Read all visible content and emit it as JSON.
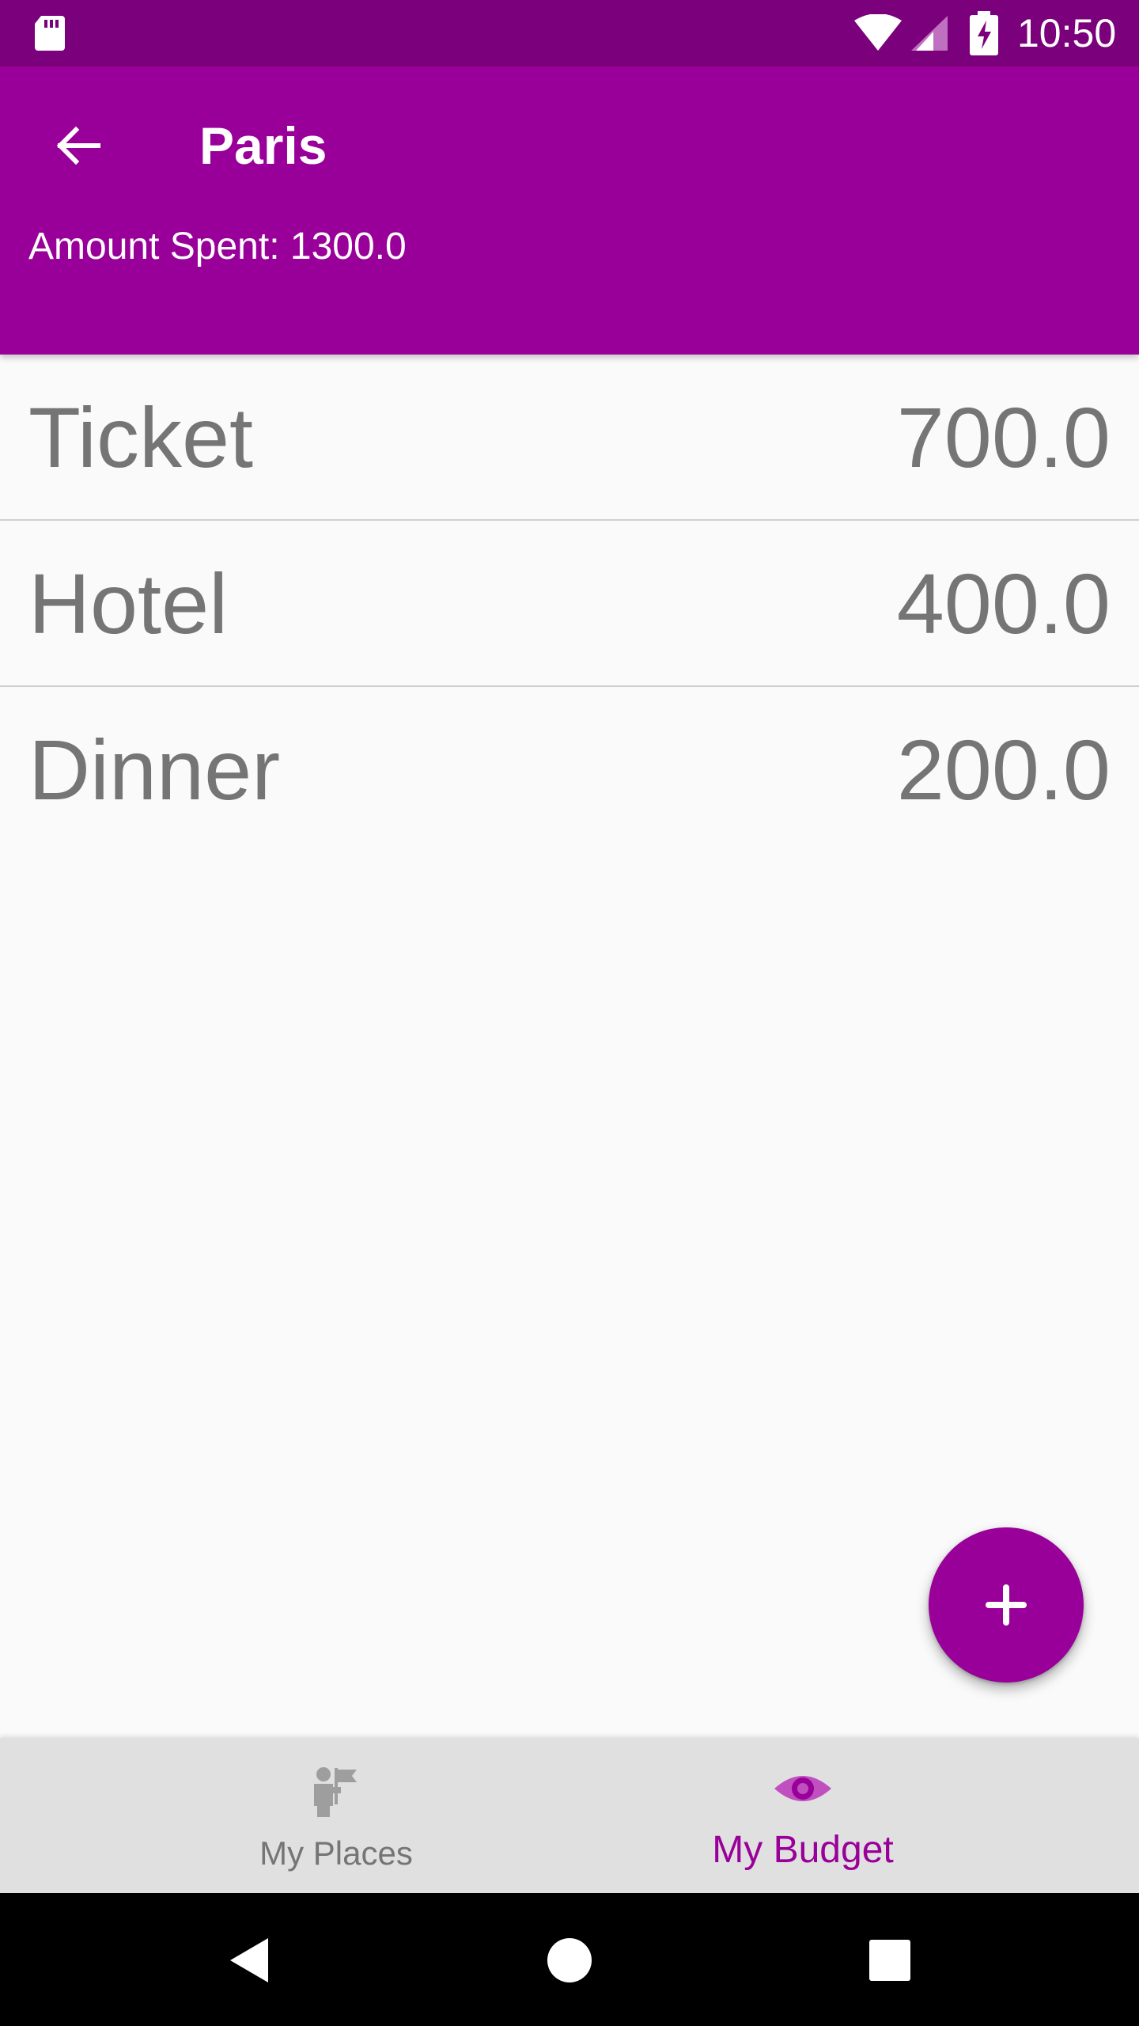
{
  "status_bar": {
    "time": "10:50",
    "icons": [
      "sd-card-icon",
      "wifi-icon",
      "cell-signal-icon",
      "battery-charging-icon"
    ]
  },
  "app_bar": {
    "title": "Paris",
    "subtitle": "Amount Spent: 1300.0",
    "back_icon": "arrow-back-icon"
  },
  "expenses": [
    {
      "name": "Ticket",
      "amount": "700.0"
    },
    {
      "name": "Hotel",
      "amount": "400.0"
    },
    {
      "name": "Dinner",
      "amount": "200.0"
    }
  ],
  "fab": {
    "icon": "plus-icon"
  },
  "bottom_nav": {
    "items": [
      {
        "label": "My Places",
        "icon": "places-icon",
        "active": false
      },
      {
        "label": "My Budget",
        "icon": "eye-icon",
        "active": true
      }
    ]
  },
  "system_nav": {
    "icons": [
      "back-triangle-icon",
      "home-circle-icon",
      "recents-square-icon"
    ]
  },
  "colors": {
    "status_bar": "#7b007b",
    "primary": "#990099",
    "text_secondary": "#757575",
    "nav_background": "#e0e0e0"
  }
}
